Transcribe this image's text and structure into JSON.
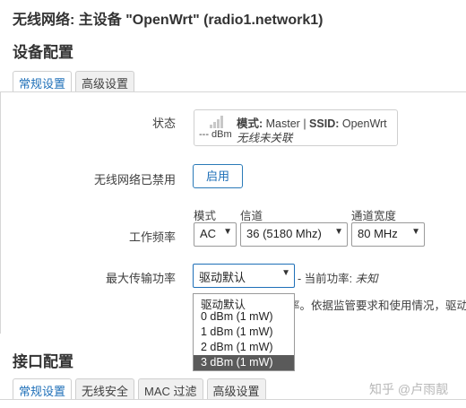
{
  "window_title": "无线网络: 主设备 \"OpenWrt\" (radio1.network1)",
  "device_config": {
    "heading": "设备配置",
    "tabs": [
      {
        "label": "常规设置",
        "active": true
      },
      {
        "label": "高级设置",
        "active": false
      }
    ]
  },
  "status_row": {
    "label": "状态",
    "signal": "--- dBm",
    "mode_key": "模式:",
    "mode_value": " Master | ",
    "ssid_key": "SSID:",
    "ssid_value": " OpenWrt",
    "connection_state": "无线未关联"
  },
  "disabled_row": {
    "label": "无线网络已禁用",
    "button_label": "启用"
  },
  "frequency_row": {
    "label": "工作频率",
    "mode_label": "模式",
    "channel_label": "信道",
    "width_label": "通道宽度",
    "mode_value": "AC",
    "channel_value": "36 (5180 Mhz)",
    "width_value": "80 MHz"
  },
  "txpower_row": {
    "label": "最大传输功率",
    "selected_value": "驱动默认",
    "current_power_label": "- 当前功率:",
    "current_power_value": "未知",
    "hint_text": "率。依据监管要求和使用情况，驱动",
    "options": [
      {
        "label": "驱动默认",
        "selected": false
      },
      {
        "label": "0 dBm (1 mW)",
        "selected": false
      },
      {
        "label": "1 dBm (1 mW)",
        "selected": false
      },
      {
        "label": "2 dBm (1 mW)",
        "selected": false
      },
      {
        "label": "3 dBm (1 mW)",
        "selected": true
      }
    ]
  },
  "interface_config": {
    "heading": "接口配置",
    "tabs": [
      {
        "label": "常规设置",
        "active": true
      },
      {
        "label": "无线安全",
        "active": false
      },
      {
        "label": "MAC 过滤",
        "active": false
      },
      {
        "label": "高级设置",
        "active": false
      }
    ]
  },
  "watermark": "知乎 @卢雨靓"
}
